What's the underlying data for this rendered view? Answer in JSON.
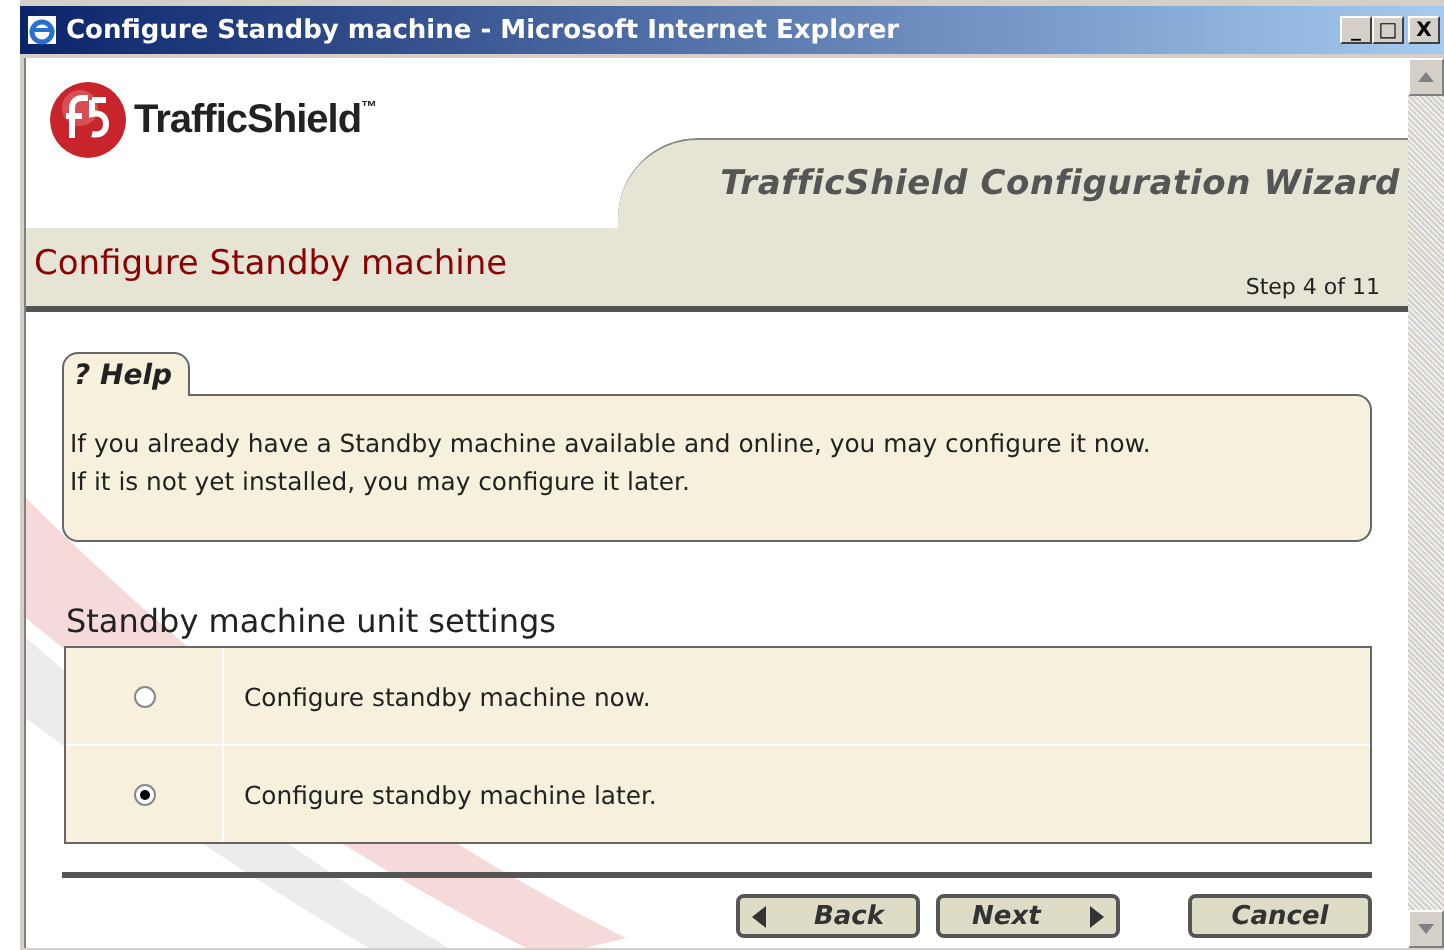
{
  "window": {
    "title": "Configure Standby machine - Microsoft Internet Explorer",
    "controls": [
      "_",
      "□",
      "X"
    ]
  },
  "header": {
    "brand": "TrafficShield",
    "trademark": "™",
    "wizard_title": "TrafficShield Configuration Wizard"
  },
  "page": {
    "title": "Configure Standby machine",
    "step": "Step 4 of 11"
  },
  "help": {
    "tab": "? Help",
    "lines": [
      "If you already have a Standby machine available and online, you may configure it now.",
      "If it is not yet installed, you may configure it later."
    ]
  },
  "settings": {
    "heading": "Standby machine unit settings",
    "options": [
      {
        "label": "Configure standby machine now.",
        "selected": false
      },
      {
        "label": "Configure standby machine later.",
        "selected": true
      }
    ]
  },
  "buttons": [
    {
      "label": "Back",
      "kind": "back"
    },
    {
      "label": "Next",
      "kind": "next"
    },
    {
      "label": "Cancel",
      "kind": "cancel"
    }
  ]
}
